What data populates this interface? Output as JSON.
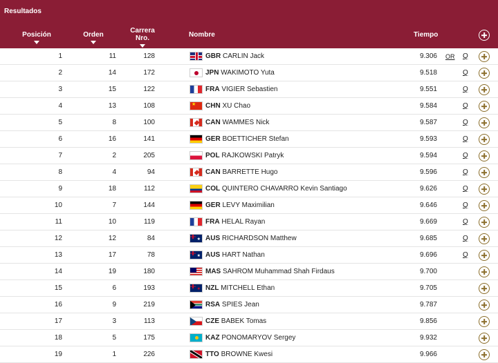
{
  "header": {
    "title": "Resultados",
    "col_posicion": "Posición",
    "col_orden": "Orden",
    "col_carrera_1": "Carrera",
    "col_carrera_2": "Nro.",
    "col_nombre": "Nombre",
    "col_tiempo": "Tiempo",
    "add_icon": "plus-circle-icon"
  },
  "colors": {
    "header_bg": "#8a1d35",
    "accent": "#8a6d2a"
  },
  "rows": [
    {
      "pos": "1",
      "orden": "11",
      "carrera": "128",
      "flag": "gbr",
      "code": "GBR",
      "name": "CARLIN Jack",
      "tiempo": "9.306",
      "or": "OR",
      "q": "Q"
    },
    {
      "pos": "2",
      "orden": "14",
      "carrera": "172",
      "flag": "jpn",
      "code": "JPN",
      "name": "WAKIMOTO Yuta",
      "tiempo": "9.518",
      "or": "",
      "q": "Q"
    },
    {
      "pos": "3",
      "orden": "15",
      "carrera": "122",
      "flag": "fra",
      "code": "FRA",
      "name": "VIGIER Sebastien",
      "tiempo": "9.551",
      "or": "",
      "q": "Q"
    },
    {
      "pos": "4",
      "orden": "13",
      "carrera": "108",
      "flag": "chn",
      "code": "CHN",
      "name": "XU Chao",
      "tiempo": "9.584",
      "or": "",
      "q": "Q"
    },
    {
      "pos": "5",
      "orden": "8",
      "carrera": "100",
      "flag": "can",
      "code": "CAN",
      "name": "WAMMES Nick",
      "tiempo": "9.587",
      "or": "",
      "q": "Q"
    },
    {
      "pos": "6",
      "orden": "16",
      "carrera": "141",
      "flag": "ger",
      "code": "GER",
      "name": "BOETTICHER Stefan",
      "tiempo": "9.593",
      "or": "",
      "q": "Q"
    },
    {
      "pos": "7",
      "orden": "2",
      "carrera": "205",
      "flag": "pol",
      "code": "POL",
      "name": "RAJKOWSKI Patryk",
      "tiempo": "9.594",
      "or": "",
      "q": "Q"
    },
    {
      "pos": "8",
      "orden": "4",
      "carrera": "94",
      "flag": "can",
      "code": "CAN",
      "name": "BARRETTE Hugo",
      "tiempo": "9.596",
      "or": "",
      "q": "Q"
    },
    {
      "pos": "9",
      "orden": "18",
      "carrera": "112",
      "flag": "col",
      "code": "COL",
      "name": "QUINTERO CHAVARRO Kevin Santiago",
      "tiempo": "9.626",
      "or": "",
      "q": "Q"
    },
    {
      "pos": "10",
      "orden": "7",
      "carrera": "144",
      "flag": "ger",
      "code": "GER",
      "name": "LEVY Maximilian",
      "tiempo": "9.646",
      "or": "",
      "q": "Q"
    },
    {
      "pos": "11",
      "orden": "10",
      "carrera": "119",
      "flag": "fra",
      "code": "FRA",
      "name": "HELAL Rayan",
      "tiempo": "9.669",
      "or": "",
      "q": "Q"
    },
    {
      "pos": "12",
      "orden": "12",
      "carrera": "84",
      "flag": "aus",
      "code": "AUS",
      "name": "RICHARDSON Matthew",
      "tiempo": "9.685",
      "or": "",
      "q": "Q"
    },
    {
      "pos": "13",
      "orden": "17",
      "carrera": "78",
      "flag": "aus",
      "code": "AUS",
      "name": "HART Nathan",
      "tiempo": "9.696",
      "or": "",
      "q": "Q"
    },
    {
      "pos": "14",
      "orden": "19",
      "carrera": "180",
      "flag": "mas",
      "code": "MAS",
      "name": "SAHROM Muhammad Shah Firdaus",
      "tiempo": "9.700",
      "or": "",
      "q": ""
    },
    {
      "pos": "15",
      "orden": "6",
      "carrera": "193",
      "flag": "nzl",
      "code": "NZL",
      "name": "MITCHELL Ethan",
      "tiempo": "9.705",
      "or": "",
      "q": ""
    },
    {
      "pos": "16",
      "orden": "9",
      "carrera": "219",
      "flag": "rsa",
      "code": "RSA",
      "name": "SPIES Jean",
      "tiempo": "9.787",
      "or": "",
      "q": ""
    },
    {
      "pos": "17",
      "orden": "3",
      "carrera": "113",
      "flag": "cze",
      "code": "CZE",
      "name": "BABEK Tomas",
      "tiempo": "9.856",
      "or": "",
      "q": ""
    },
    {
      "pos": "18",
      "orden": "5",
      "carrera": "175",
      "flag": "kaz",
      "code": "KAZ",
      "name": "PONOMARYOV Sergey",
      "tiempo": "9.932",
      "or": "",
      "q": ""
    },
    {
      "pos": "19",
      "orden": "1",
      "carrera": "226",
      "flag": "tto",
      "code": "TTO",
      "name": "BROWNE Kwesi",
      "tiempo": "9.966",
      "or": "",
      "q": ""
    }
  ]
}
